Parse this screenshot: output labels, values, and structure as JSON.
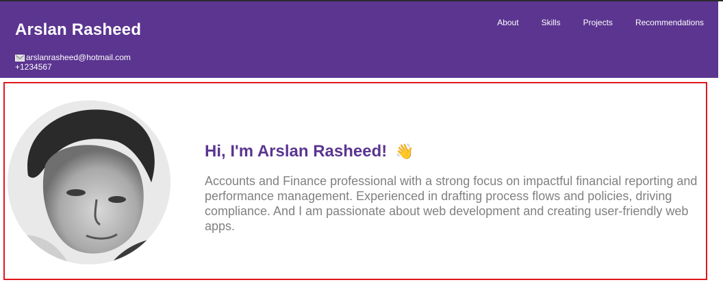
{
  "header": {
    "name": "Arslan Rasheed",
    "email": "arslanrasheed@hotmail.com",
    "phone": "+1234567",
    "email_icon": "envelope-icon",
    "nav": [
      {
        "label": "About"
      },
      {
        "label": "Skills"
      },
      {
        "label": "Projects"
      },
      {
        "label": "Recommendations"
      }
    ]
  },
  "hero": {
    "greeting": "Hi, I'm Arslan Rasheed!",
    "wave_icon": "👋",
    "bio": "Accounts and Finance professional with a strong focus on impactful financial reporting and performance management. Experienced in drafting process flows and policies, driving compliance. And I am passionate about web development and creating user-friendly web apps."
  },
  "colors": {
    "header_bg": "#5b3590",
    "accent": "#5b3590",
    "highlight_border": "#e0151b",
    "bio_text": "#808080"
  }
}
